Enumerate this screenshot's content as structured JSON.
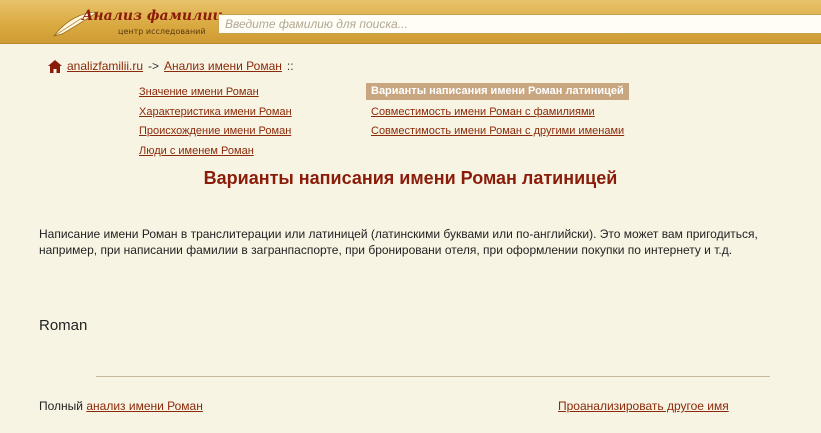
{
  "header": {
    "logo_title": "Анализ фамилии",
    "logo_subtitle": "центр исследований",
    "search_placeholder": "Введите фамилию для поиска..."
  },
  "breadcrumb": {
    "home_label": "analizfamilii.ru",
    "arrow": "->",
    "current_label": "Анализ имени Роман",
    "trail": "::"
  },
  "menu": {
    "left": [
      "Значение имени Роман",
      "Характеристика имени Роман",
      "Происхождение имени Роман",
      "Люди с именем Роман"
    ],
    "right_active": "Варианты написания имени Роман латиницей",
    "right": [
      "Совместимость имени Роман с фамилиями",
      "Совместимость имени Роман с другими именами"
    ]
  },
  "content": {
    "title": "Варианты написания имени Роман латиницей",
    "description": "Написание имени Роман в транслитерации или латиницей (латинскими буквами или по-английски). Это может вам пригодиться, например, при написании фамилии в загранпаспорте, при бронировани отеля, при оформлении покупки по интернету и т.д.",
    "result": "Roman"
  },
  "footer": {
    "left_prefix": "Полный",
    "left_link": "анализ имени Роман",
    "right_link": "Проанализировать другое имя"
  },
  "colors": {
    "accent": "#8a1c0a",
    "header_gold": "#d9a940",
    "background": "#f8f4e4",
    "active_menu": "#c8a680"
  }
}
